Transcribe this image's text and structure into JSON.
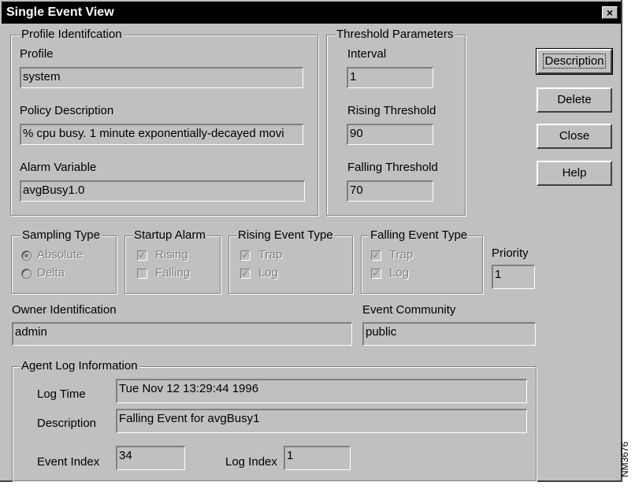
{
  "window": {
    "title": "Single Event View",
    "close_glyph": "×"
  },
  "profile_group": {
    "legend": "Profile Identifcation",
    "profile_label": "Profile",
    "profile_value": "system",
    "policy_label": "Policy Description",
    "policy_value": "% cpu busy. 1 minute exponentially-decayed movi",
    "alarm_label": "Alarm Variable",
    "alarm_value": "avgBusy1.0"
  },
  "threshold_group": {
    "legend": "Threshold Parameters",
    "interval_label": "Interval",
    "interval_value": "1",
    "rising_label": "Rising Threshold",
    "rising_value": "90",
    "falling_label": "Falling Threshold",
    "falling_value": "70"
  },
  "buttons": {
    "description": "Description",
    "delete": "Delete",
    "close": "Close",
    "help": "Help"
  },
  "sampling": {
    "legend": "Sampling Type",
    "absolute": "Absolute",
    "delta": "Delta",
    "selected": "Absolute"
  },
  "startup": {
    "legend": "Startup Alarm",
    "rising": "Rising",
    "falling": "Falling",
    "rising_checked": true,
    "falling_checked": false
  },
  "rising_event": {
    "legend": "Rising Event Type",
    "trap": "Trap",
    "log": "Log",
    "trap_checked": true,
    "log_checked": true
  },
  "falling_event": {
    "legend": "Falling Event Type",
    "trap": "Trap",
    "log": "Log",
    "trap_checked": true,
    "log_checked": true
  },
  "priority": {
    "label": "Priority",
    "value": "1"
  },
  "owner": {
    "label": "Owner Identification",
    "value": "admin"
  },
  "community": {
    "label": "Event Community",
    "value": "public"
  },
  "agent_log": {
    "legend": "Agent Log Information",
    "log_time_label": "Log Time",
    "log_time_value": "Tue Nov 12 13:29:44 1996",
    "description_label": "Description",
    "description_value": "Falling Event for avgBusy1",
    "event_index_label": "Event Index",
    "event_index_value": "34",
    "log_index_label": "Log Index",
    "log_index_value": "1"
  },
  "check_glyph": "✓",
  "watermark": "NM3676"
}
